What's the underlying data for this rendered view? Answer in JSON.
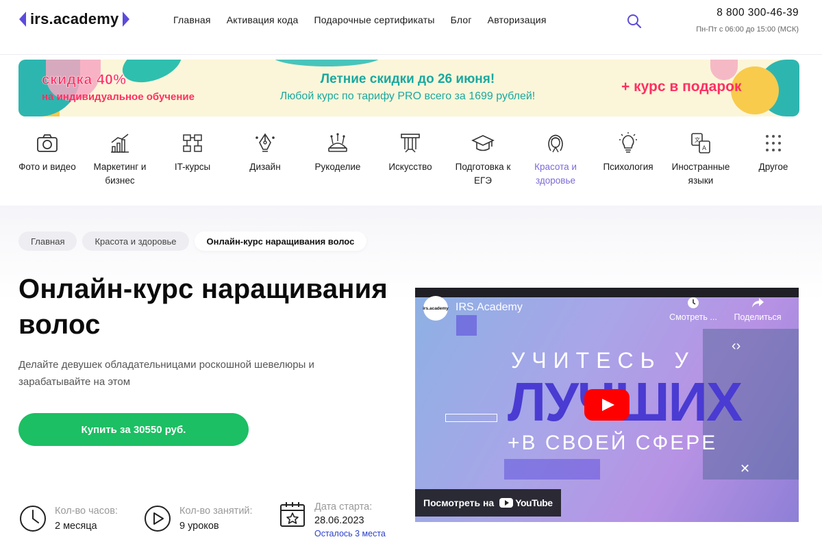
{
  "header": {
    "logo_text": "irs.academy",
    "nav": [
      "Главная",
      "Активация кода",
      "Подарочные сертификаты",
      "Блог",
      "Авторизация"
    ],
    "phone": "8 800 300-46-39",
    "hours": "Пн-Пт с 06:00 до 15:00 (МСК)",
    "accent": "#5b4bdb"
  },
  "banner": {
    "discount": "скидка 40%",
    "discount_sub": "на индивидуальное обучение",
    "title": "Летние скидки до 26 июня!",
    "subtitle": "Любой курс по тарифу PRO всего за 1699 рублей!",
    "gift": "+ курс в подарок"
  },
  "categories": [
    {
      "label": "Фото и видео",
      "icon": "camera-icon"
    },
    {
      "label": "Маркетинг и бизнес",
      "icon": "chart-icon"
    },
    {
      "label": "IT-курсы",
      "icon": "network-icon"
    },
    {
      "label": "Дизайн",
      "icon": "pen-tool-icon"
    },
    {
      "label": "Рукоделие",
      "icon": "pincushion-icon"
    },
    {
      "label": "Искусство",
      "icon": "column-icon"
    },
    {
      "label": "Подготовка к ЕГЭ",
      "icon": "graduation-cap-icon"
    },
    {
      "label": "Красота и здоровье",
      "icon": "woman-face-icon",
      "active": true
    },
    {
      "label": "Психология",
      "icon": "lightbulb-icon"
    },
    {
      "label": "Иностранные языки",
      "icon": "translate-icon"
    },
    {
      "label": "Другое",
      "icon": "grid-dots-icon"
    }
  ],
  "breadcrumbs": [
    "Главная",
    "Красота и здоровье",
    "Онлайн-курс наращивания волос"
  ],
  "course": {
    "title": "Онлайн-курс наращивания волос",
    "description": "Делайте девушек обладательницами роскошной шевелюры и зарабатывайте на этом",
    "buy_label": "Купить за 30550 руб.",
    "buy_color": "#1cbf63"
  },
  "stats": [
    {
      "key": "Кол-во часов:",
      "value": "2 месяца",
      "icon": "clock-icon"
    },
    {
      "key": "Кол-во занятий:",
      "value": "9 уроков",
      "icon": "play-circle-icon"
    },
    {
      "key": "Дата старта:",
      "value": "28.06.2023",
      "note": "Осталось 3 места",
      "icon": "calendar-star-icon"
    }
  ],
  "video": {
    "channel_logo": "irs.academy",
    "channel": "IRS.Academy",
    "watch_later": "Смотреть ...",
    "share": "Поделиться",
    "line1": "УЧИТЕСЬ У",
    "line2": "ЛУЧШИХ",
    "line3": "+В СВОЕЙ СФЕРЕ",
    "watch_on": "Посмотреть на",
    "youtube": "YouTube"
  }
}
